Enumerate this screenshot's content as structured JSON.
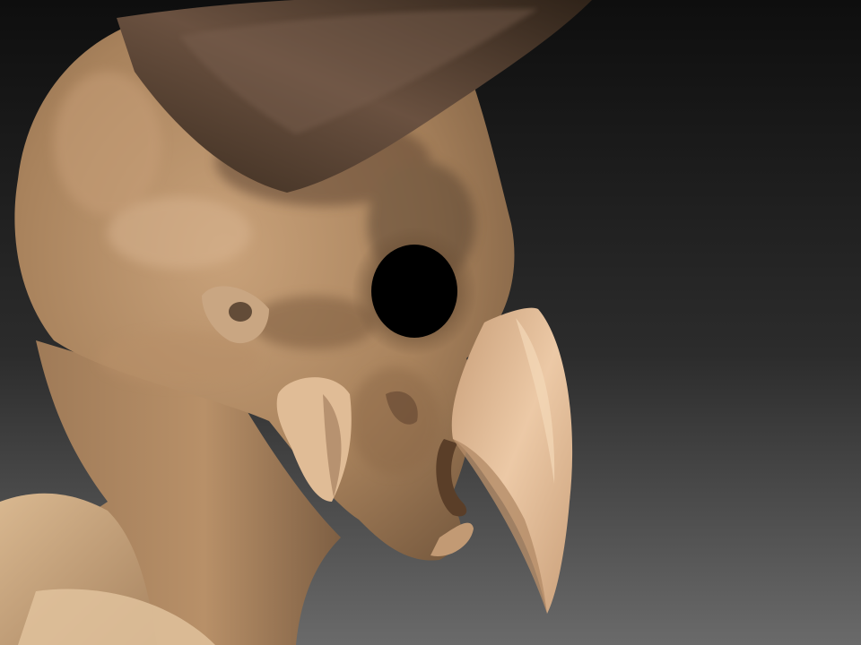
{
  "scene": {
    "subject": "creature-head-sculpt",
    "background_gradient": [
      "#0e0e0e",
      "#6a6a6a"
    ],
    "colors": {
      "skin_base": "#b08a64",
      "skin_light": "#d9b48e",
      "skin_dark": "#6e5238",
      "horn": "#5a4332",
      "horn_dark": "#2e2218",
      "beak": "#e2bd98",
      "beak_shadow": "#a98260",
      "eye_socket": "#000000",
      "shoulder": "#c7a27c"
    }
  }
}
